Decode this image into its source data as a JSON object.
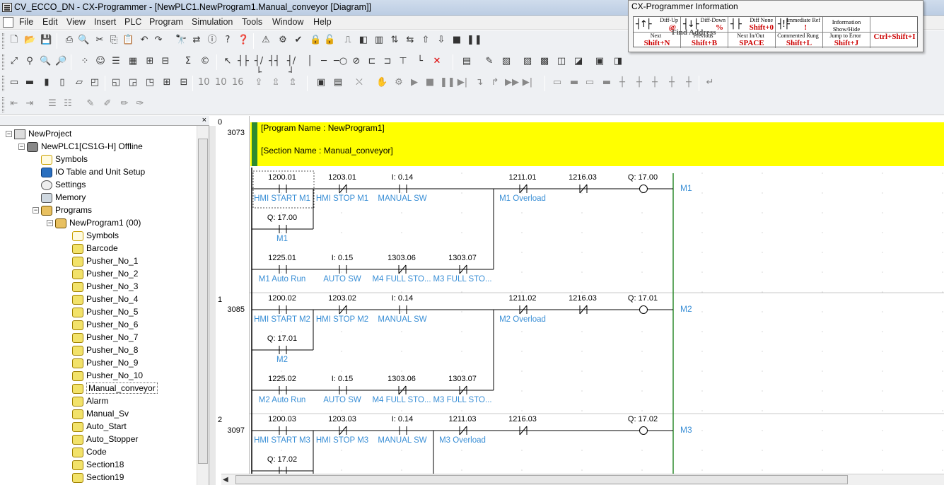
{
  "window": {
    "title": "CV_ECCO_DN - CX-Programmer - [NewPLC1.NewProgram1.Manual_conveyor [Diagram]]"
  },
  "menu": [
    "File",
    "Edit",
    "View",
    "Insert",
    "PLC",
    "Program",
    "Simulation",
    "Tools",
    "Window",
    "Help"
  ],
  "info_panel": {
    "title": "CX-Programmer Information",
    "cells": [
      {
        "label": "Diff-Up",
        "key": "@",
        "sym": "┤↑├"
      },
      {
        "label": "Diff-Down",
        "key": "%",
        "sym": "┤↓├"
      },
      {
        "label": "Diff None",
        "key": "Shift+0",
        "sym": "┤ ├"
      },
      {
        "label": "Immediate Ref",
        "key": "!",
        "sym": "┤!├"
      },
      {
        "label": "Information Show/Hide",
        "key": "",
        "sym": ""
      },
      {
        "label": "Next",
        "key": "Shift+N",
        "sym": ""
      },
      {
        "label": "Previous",
        "key": "Shift+B",
        "sym": ""
      },
      {
        "label": "Next In/Out",
        "key": "SPACE",
        "sym": ""
      },
      {
        "label": "Commented Rung",
        "key": "Shift+L",
        "sym": ""
      },
      {
        "label": "Jump to Error",
        "key": "Shift+J",
        "sym": ""
      },
      {
        "label": "",
        "key": "Ctrl+Shift+I",
        "sym": ""
      }
    ],
    "find_address": "Find Address"
  },
  "tree": {
    "close_label": "×",
    "items": [
      {
        "label": "NewProject",
        "icon": "project-icon",
        "level": 0
      },
      {
        "label": "NewPLC1[CS1G-H] Offline",
        "icon": "plc-icon",
        "level": 1
      },
      {
        "label": "Symbols",
        "icon": "symbols-icon",
        "level": 2
      },
      {
        "label": "IO Table and Unit Setup",
        "icon": "io-table-icon",
        "level": 2
      },
      {
        "label": "Settings",
        "icon": "settings-icon",
        "level": 2
      },
      {
        "label": "Memory",
        "icon": "memory-icon",
        "level": 2
      },
      {
        "label": "Programs",
        "icon": "programs-icon",
        "level": 2
      },
      {
        "label": "NewProgram1 (00)",
        "icon": "program-icon",
        "level": 3
      },
      {
        "label": "Symbols",
        "icon": "symbols-icon",
        "level": 4
      },
      {
        "label": "Barcode",
        "icon": "section-icon",
        "level": 4
      },
      {
        "label": "Pusher_No_1",
        "icon": "section-icon",
        "level": 4
      },
      {
        "label": "Pusher_No_2",
        "icon": "section-icon",
        "level": 4
      },
      {
        "label": "Pusher_No_3",
        "icon": "section-icon",
        "level": 4
      },
      {
        "label": "Pusher_No_4",
        "icon": "section-icon",
        "level": 4
      },
      {
        "label": "Pusher_No_5",
        "icon": "section-icon",
        "level": 4
      },
      {
        "label": "Pusher_No_6",
        "icon": "section-icon",
        "level": 4
      },
      {
        "label": "Pusher_No_7",
        "icon": "section-icon",
        "level": 4
      },
      {
        "label": "Pusher_No_8",
        "icon": "section-icon",
        "level": 4
      },
      {
        "label": "Pusher_No_9",
        "icon": "section-icon",
        "level": 4
      },
      {
        "label": "Pusher_No_10",
        "icon": "section-icon",
        "level": 4
      },
      {
        "label": "Manual_conveyor",
        "icon": "section-icon",
        "level": 4
      },
      {
        "label": "Alarm",
        "icon": "section-icon",
        "level": 4
      },
      {
        "label": "Manual_Sv",
        "icon": "section-icon",
        "level": 4
      },
      {
        "label": "Auto_Start",
        "icon": "section-icon",
        "level": 4
      },
      {
        "label": "Auto_Stopper",
        "icon": "section-icon",
        "level": 4
      },
      {
        "label": "Code",
        "icon": "section-icon",
        "level": 4
      },
      {
        "label": "Section18",
        "icon": "section-icon",
        "level": 4
      },
      {
        "label": "Section19",
        "icon": "section-icon",
        "level": 4
      }
    ]
  },
  "comment": {
    "program": "[Program Name : NewProgram1]",
    "section": "[Section Name : Manual_conveyor]"
  },
  "rungs": [
    {
      "no": "0",
      "step": "3073"
    },
    {
      "no": "1",
      "step": "3085"
    },
    {
      "no": "2",
      "step": "3097"
    }
  ],
  "contacts": [
    {
      "addr": "1200.01",
      "sym": "HMI START M1",
      "type": "NO"
    },
    {
      "addr": "1203.01",
      "sym": "HMI STOP M1",
      "type": "NC"
    },
    {
      "addr": "I: 0.14",
      "sym": "MANUAL SW",
      "type": "NO"
    },
    {
      "addr": "1211.01",
      "sym": "M1 Overload",
      "type": "NC"
    },
    {
      "addr": "1216.03",
      "sym": "",
      "type": "NC"
    },
    {
      "addr": "Q: 17.00",
      "sym": "M1",
      "type": "NO"
    },
    {
      "addr": "1225.01",
      "sym": "M1 Auto Run",
      "type": "NO"
    },
    {
      "addr": "I: 0.15",
      "sym": "AUTO SW",
      "type": "NO"
    },
    {
      "addr": "1303.06",
      "sym": "M4 FULL STO...",
      "type": "NC"
    },
    {
      "addr": "1303.07",
      "sym": "M3 FULL STO...",
      "type": "NC"
    },
    {
      "addr": "1200.02",
      "sym": "HMI START M2",
      "type": "NO"
    },
    {
      "addr": "1203.02",
      "sym": "HMI STOP M2",
      "type": "NC"
    },
    {
      "addr": "I: 0.14",
      "sym": "MANUAL SW",
      "type": "NO"
    },
    {
      "addr": "1211.02",
      "sym": "M2 Overload",
      "type": "NC"
    },
    {
      "addr": "1216.03",
      "sym": "",
      "type": "NC"
    },
    {
      "addr": "Q: 17.01",
      "sym": "M2",
      "type": "NO"
    },
    {
      "addr": "1225.02",
      "sym": "M2 Auto Run",
      "type": "NO"
    },
    {
      "addr": "I: 0.15",
      "sym": "AUTO SW",
      "type": "NO"
    },
    {
      "addr": "1303.06",
      "sym": "M4 FULL STO...",
      "type": "NC"
    },
    {
      "addr": "1303.07",
      "sym": "M3 FULL STO...",
      "type": "NC"
    },
    {
      "addr": "1200.03",
      "sym": "HMI START M3",
      "type": "NO"
    },
    {
      "addr": "1203.03",
      "sym": "HMI STOP M3",
      "type": "NC"
    },
    {
      "addr": "I: 0.14",
      "sym": "MANUAL SW",
      "type": "NO"
    },
    {
      "addr": "1211.03",
      "sym": "M3 Overload",
      "type": "NC"
    },
    {
      "addr": "1216.03",
      "sym": "",
      "type": "NC"
    },
    {
      "addr": "Q: 17.02",
      "sym": "",
      "type": "NO"
    }
  ],
  "coils": [
    {
      "addr": "Q: 17.00",
      "sym": "M1"
    },
    {
      "addr": "Q: 17.01",
      "sym": "M2"
    },
    {
      "addr": "Q: 17.02",
      "sym": "M3"
    }
  ]
}
